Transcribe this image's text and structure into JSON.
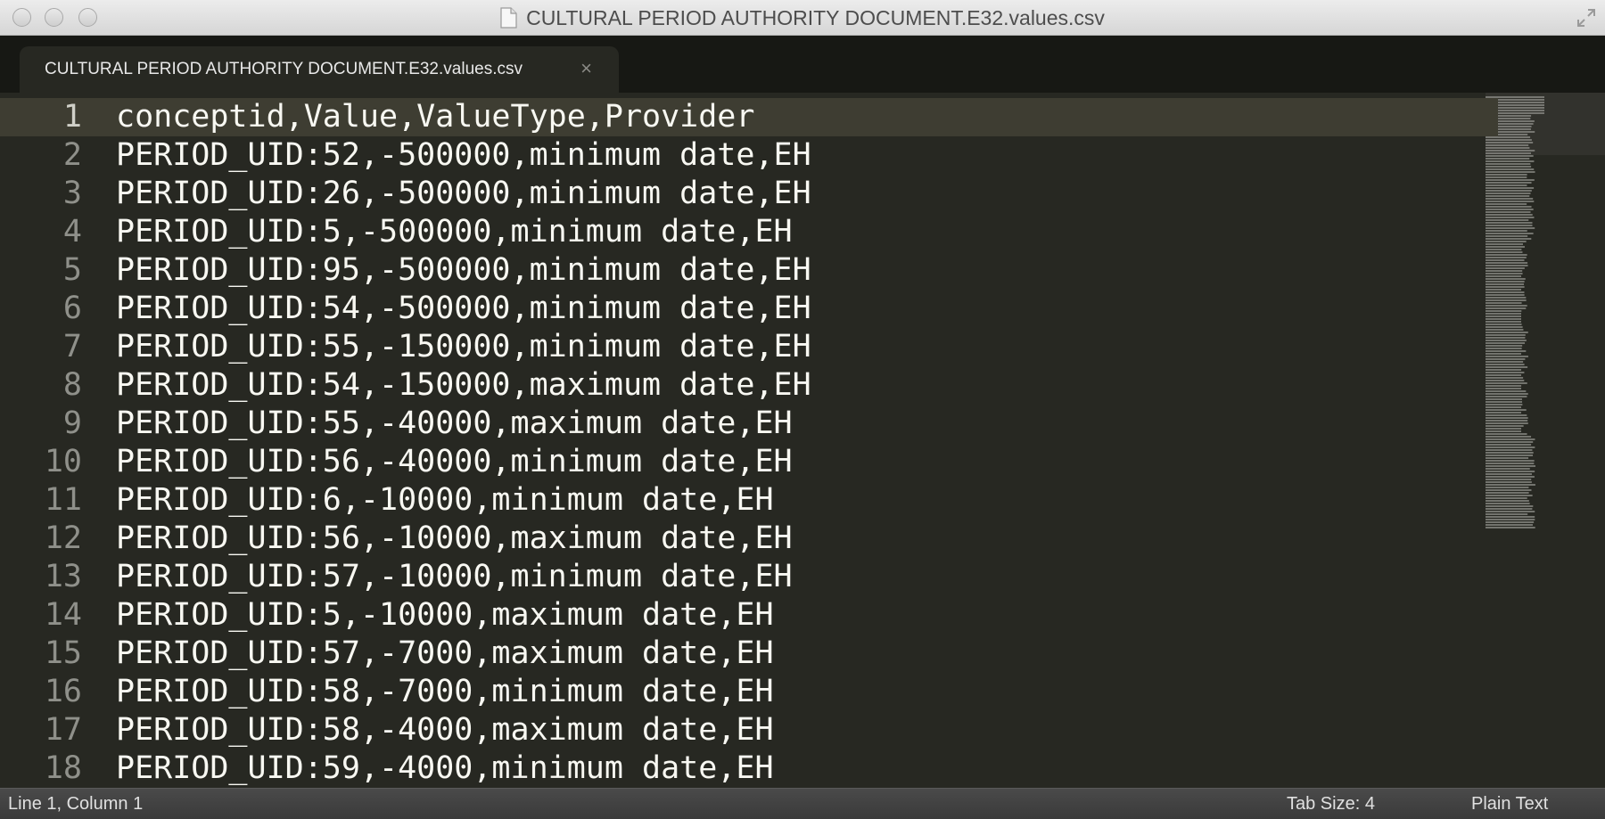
{
  "window": {
    "title": "CULTURAL PERIOD AUTHORITY DOCUMENT.E32.values.csv"
  },
  "tab": {
    "label": "CULTURAL PERIOD AUTHORITY DOCUMENT.E32.values.csv",
    "close_glyph": "×"
  },
  "editor": {
    "lines": [
      {
        "num": "1",
        "text": "conceptid,Value,ValueType,Provider"
      },
      {
        "num": "2",
        "text": "PERIOD_UID:52,-500000,minimum date,EH"
      },
      {
        "num": "3",
        "text": "PERIOD_UID:26,-500000,minimum date,EH"
      },
      {
        "num": "4",
        "text": "PERIOD_UID:5,-500000,minimum date,EH"
      },
      {
        "num": "5",
        "text": "PERIOD_UID:95,-500000,minimum date,EH"
      },
      {
        "num": "6",
        "text": "PERIOD_UID:54,-500000,minimum date,EH"
      },
      {
        "num": "7",
        "text": "PERIOD_UID:55,-150000,minimum date,EH"
      },
      {
        "num": "8",
        "text": "PERIOD_UID:54,-150000,maximum date,EH"
      },
      {
        "num": "9",
        "text": "PERIOD_UID:55,-40000,maximum date,EH"
      },
      {
        "num": "10",
        "text": "PERIOD_UID:56,-40000,minimum date,EH"
      },
      {
        "num": "11",
        "text": "PERIOD_UID:6,-10000,minimum date,EH"
      },
      {
        "num": "12",
        "text": "PERIOD_UID:56,-10000,maximum date,EH"
      },
      {
        "num": "13",
        "text": "PERIOD_UID:57,-10000,minimum date,EH"
      },
      {
        "num": "14",
        "text": "PERIOD_UID:5,-10000,maximum date,EH"
      },
      {
        "num": "15",
        "text": "PERIOD_UID:57,-7000,maximum date,EH"
      },
      {
        "num": "16",
        "text": "PERIOD_UID:58,-7000,minimum date,EH"
      },
      {
        "num": "17",
        "text": "PERIOD_UID:58,-4000,maximum date,EH"
      },
      {
        "num": "18",
        "text": "PERIOD_UID:59,-4000,minimum date,EH"
      }
    ],
    "current_line_index": 0
  },
  "statusbar": {
    "position": "Line 1, Column 1",
    "tab_size": "Tab Size: 4",
    "syntax": "Plain Text"
  },
  "colors": {
    "editor_bg": "#272822",
    "current_line_bg": "#3e3d32",
    "text": "#f8f8f2",
    "gutter_text": "#8f908a"
  },
  "icons": {
    "window_close": "close-button",
    "window_minimize": "minimize-button",
    "window_zoom": "zoom-button",
    "file": "document-icon",
    "fullscreen": "fullscreen-icon"
  }
}
